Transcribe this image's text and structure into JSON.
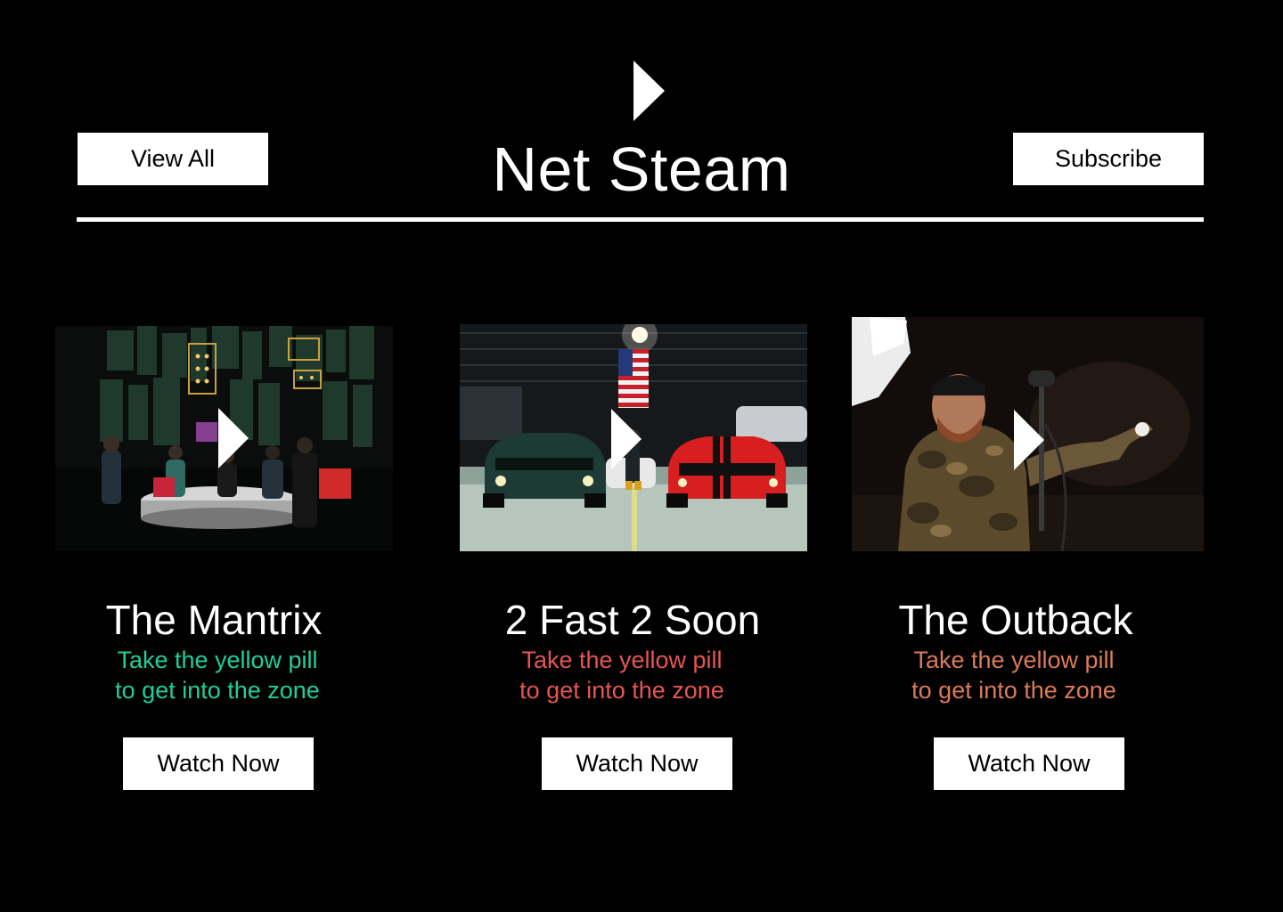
{
  "header": {
    "logo_icon": "play-triangle-icon",
    "title": "Net Steam",
    "view_all_label": "View All",
    "subscribe_label": "Subscribe"
  },
  "cards": [
    {
      "title": "The Mantrix",
      "tagline_line1": "Take the yellow pill",
      "tagline_line2": "to get into the zone",
      "tagline_color": "#1fcf9a",
      "button_label": "Watch Now",
      "play_icon": "play-icon"
    },
    {
      "title": "2 Fast 2 Soon",
      "tagline_line1": "Take the yellow pill",
      "tagline_line2": "to get into the zone",
      "tagline_color": "#e65555",
      "button_label": "Watch Now",
      "play_icon": "play-icon"
    },
    {
      "title": "The Outback",
      "tagline_line1": "Take the yellow pill",
      "tagline_line2": "to get into the zone",
      "tagline_color": "#dc7a5a",
      "button_label": "Watch Now",
      "play_icon": "play-icon"
    }
  ],
  "colors": {
    "background": "#000000",
    "text": "#ffffff",
    "button_bg": "#ffffff",
    "button_text": "#000000"
  }
}
